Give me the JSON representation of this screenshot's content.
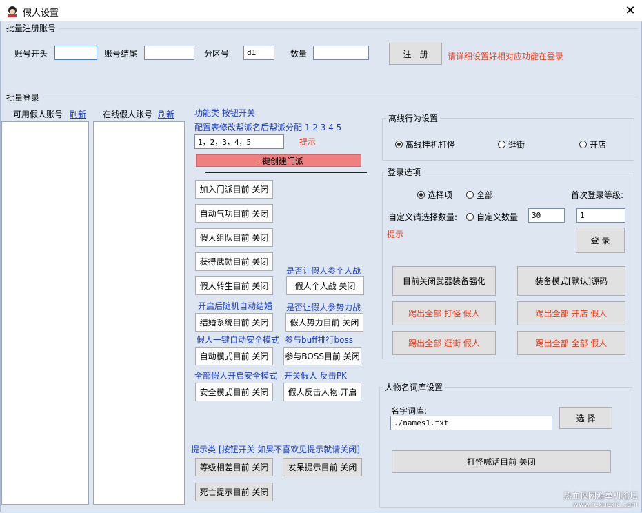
{
  "window": {
    "title": "假人设置",
    "close_glyph": "✕"
  },
  "batch_register": {
    "section_title": "批量注册账号",
    "account_prefix_label": "账号开头",
    "account_prefix_value": "",
    "account_suffix_label": "账号结尾",
    "account_suffix_value": "",
    "zone_label": "分区号",
    "zone_value": "d1",
    "count_label": "数量",
    "count_value": "",
    "register_button": "注　册",
    "hint": "请详细设置好相对应功能在登录"
  },
  "batch_login": {
    "section_title": "批量登录",
    "available_label": "可用假人账号",
    "refresh_label": "刷新",
    "online_label": "在线假人账号",
    "refresh2_label": "刷新"
  },
  "functions": {
    "header": "功能类  按钮开关",
    "config_hint": "配置表修改帮派名后帮派分配 1 2 3 4 5",
    "faction_input": "1，2，3，4，5",
    "tip_label": "提示",
    "create_faction_button": "一键创建门派",
    "join_faction_button": "加入门派目前 关闭",
    "auto_qigong_button": "自动气功目前 关闭",
    "team_button": "假人组队目前 关闭",
    "medal_button": "获得武勋目前 关闭",
    "rebirth_button": "假人转生目前 关闭",
    "pvp_question": "是否让假人参个人战",
    "pvp_button": "假人个人战 关闭",
    "marriage_label": "开启后随机自动结婚",
    "force_question": "是否让假人参势力战",
    "marriage_button": "结婚系统目前 关闭",
    "force_button": "假人势力目前 关闭",
    "auto_safe_label": "假人一键自动安全模式",
    "buff_label": "参与buff排行boss",
    "auto_mode_button": "自动模式目前 关闭",
    "boss_button": "参与BOSS目前 关闭",
    "all_safe_label": "全部假人开启安全模式",
    "counter_label": "开关假人 反击PK",
    "safe_mode_button": "安全模式目前 关闭",
    "counter_button": "假人反击人物 开启",
    "notice_header": "提示类 [按钮开关 如果不喜欢见提示就请关闭]",
    "level_diff_button": "等级相差目前 关闭",
    "daze_button": "发呆提示目前 关闭",
    "death_button": "死亡提示目前 关闭"
  },
  "offline": {
    "title": "离线行为设置",
    "options": [
      "离线挂机打怪",
      "逛街",
      "开店"
    ],
    "selected": 0
  },
  "login_options": {
    "title": "登录选项",
    "select_label": "选择项",
    "all_label": "全部",
    "first_level_label": "首次登录等级:",
    "custom_count_label": "自定义请选择数量:",
    "custom_radio_label": "自定义数量",
    "count_value": "30",
    "level_value": "1",
    "tip_label": "提示",
    "login_button": "登 录",
    "weapon_button": "目前关闭武器装备强化",
    "equip_mode_button": "装备模式[默认]源码",
    "kick_fight_button": "踢出全部 打怪 假人",
    "kick_shop_button": "踢出全部 开店 假人",
    "kick_street_button": "踢出全部 逛街 假人",
    "kick_all_button": "踢出全部 全部 假人"
  },
  "names": {
    "title": "人物名词库设置",
    "dict_label": "名字词库:",
    "dict_value": "./names1.txt",
    "select_button": "选 择",
    "shout_button": "打怪喊话目前 关闭"
  },
  "watermark": {
    "line1": "热血侠网游单机论坛",
    "line2": "www.rexuexia.com"
  }
}
